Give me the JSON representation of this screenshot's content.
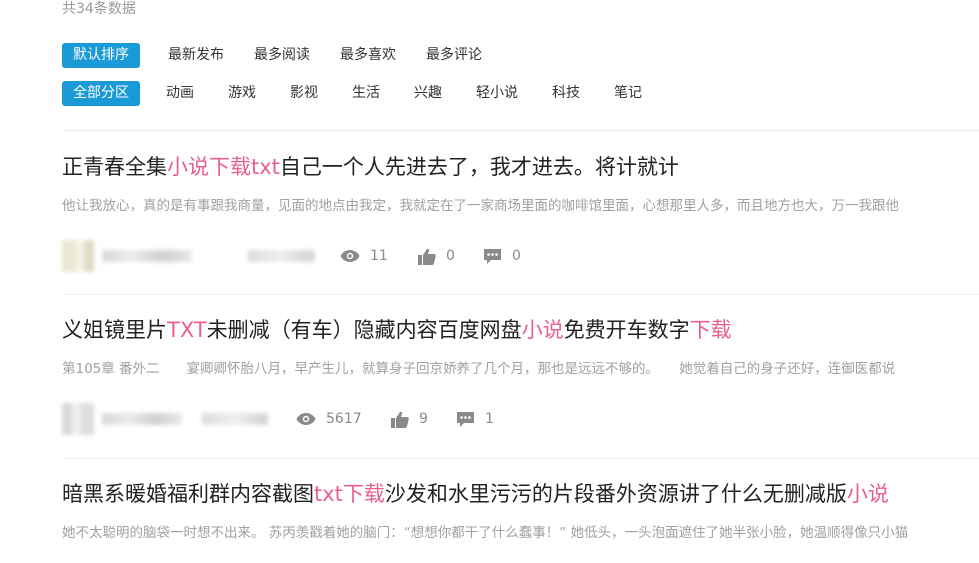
{
  "summary": {
    "total_text": "共34条数据"
  },
  "sort_tabs": [
    "默认排序",
    "最新发布",
    "最多阅读",
    "最多喜欢",
    "最多评论"
  ],
  "category_tabs": [
    "全部分区",
    "动画",
    "游戏",
    "影视",
    "生活",
    "兴趣",
    "轻小说",
    "科技",
    "笔记"
  ],
  "articles": [
    {
      "title_parts": [
        "正青春全集",
        "小说下载txt",
        "自己一个人先进去了，我才进去。将计就计"
      ],
      "excerpt": "他让我放心，真的是有事跟我商量，见面的地点由我定，我就定在了一家商场里面的咖啡馆里面，心想那里人多，而且地方也大，万一我跟他",
      "views": "11",
      "likes": "0",
      "comments": "0"
    },
    {
      "title_parts": [
        "义姐镜里片",
        "TXT",
        "未删减（有车）隐藏内容百度网盘",
        "小说",
        "免费开车数字",
        "下载"
      ],
      "excerpt": "第105章 番外二　　宴卿卿怀胎八月，早产生儿，就算身子回京娇养了几个月，那也是远远不够的。　　她觉着自己的身子还好，连御医都说",
      "views": "5617",
      "likes": "9",
      "comments": "1"
    },
    {
      "title_parts": [
        "暗黑系暖婚福利群内容截图",
        "txt下载",
        "沙发和水里污污的片段番外资源讲了什么无删减版",
        "小说"
      ],
      "excerpt": "她不太聪明的脑袋一时想不出来。 苏丙羡戳着她的脑门：“想想你都干了什么蠢事！” 她低头，一头泡面遮住了她半张小脸，她温顺得像只小猫"
    }
  ],
  "colors": {
    "accent": "#1a9bd7",
    "highlight": "#ea5f90"
  },
  "icons": {
    "views": "eye-icon",
    "likes": "thumbs-up-icon",
    "comments": "comment-icon"
  }
}
